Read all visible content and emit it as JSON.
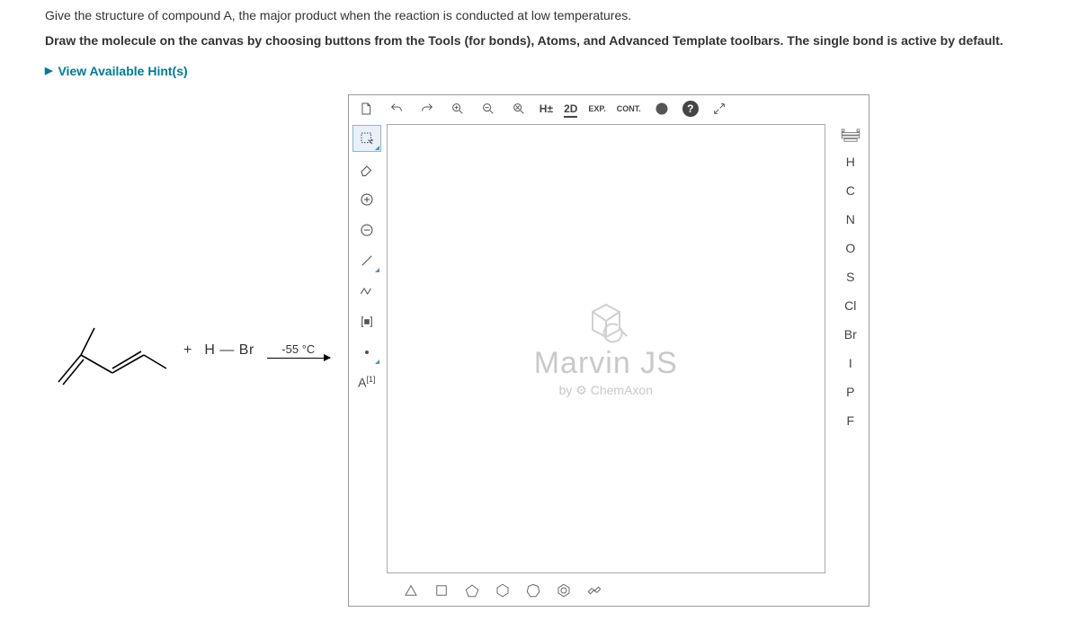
{
  "question": "Give the structure of compound A, the major product when the reaction is conducted at low temperatures.",
  "instruction": "Draw the molecule on the canvas by choosing buttons from the Tools (for bonds), Atoms, and Advanced Template toolbars. The single bond is active by default.",
  "hints_label": "View Available Hint(s)",
  "reaction": {
    "plus": "+",
    "reagent": "H — Br",
    "temperature": "-55 °C"
  },
  "editor": {
    "top_toolbar": {
      "h_toggle": "H±",
      "two_d": "2D",
      "exp": "EXP.",
      "cont": "CONT."
    },
    "left_toolbar": {
      "abbr": "A",
      "abbr_sup": "[1]"
    },
    "watermark": {
      "title": "Marvin JS",
      "by": "by",
      "brand": "ChemAxon"
    },
    "atoms": [
      "H",
      "C",
      "N",
      "O",
      "S",
      "Cl",
      "Br",
      "I",
      "P",
      "F"
    ]
  }
}
